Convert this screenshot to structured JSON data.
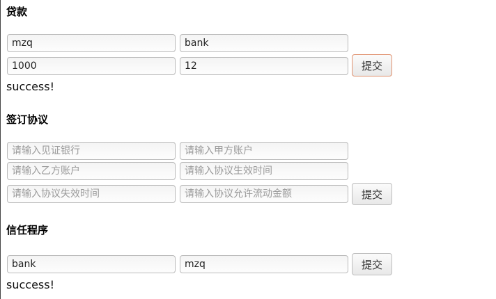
{
  "loan": {
    "heading": "贷款",
    "fields": [
      {
        "value": "mzq",
        "placeholder": ""
      },
      {
        "value": "bank",
        "placeholder": ""
      },
      {
        "value": "1000",
        "placeholder": ""
      },
      {
        "value": "12",
        "placeholder": ""
      }
    ],
    "submit_label": "提交",
    "status": "success!"
  },
  "agreement": {
    "heading": "签订协议",
    "fields": [
      {
        "value": "",
        "placeholder": "请输入见证银行"
      },
      {
        "value": "",
        "placeholder": "请输入甲方账户"
      },
      {
        "value": "",
        "placeholder": "请输入乙方账户"
      },
      {
        "value": "",
        "placeholder": "请输入协议生效时间"
      },
      {
        "value": "",
        "placeholder": "请输入协议失效时间"
      },
      {
        "value": "",
        "placeholder": "请输入协议允许流动金额"
      }
    ],
    "submit_label": "提交"
  },
  "trust": {
    "heading": "信任程序",
    "fields": [
      {
        "value": "bank",
        "placeholder": ""
      },
      {
        "value": "mzq",
        "placeholder": ""
      }
    ],
    "submit_label": "提交",
    "status": "success!"
  }
}
